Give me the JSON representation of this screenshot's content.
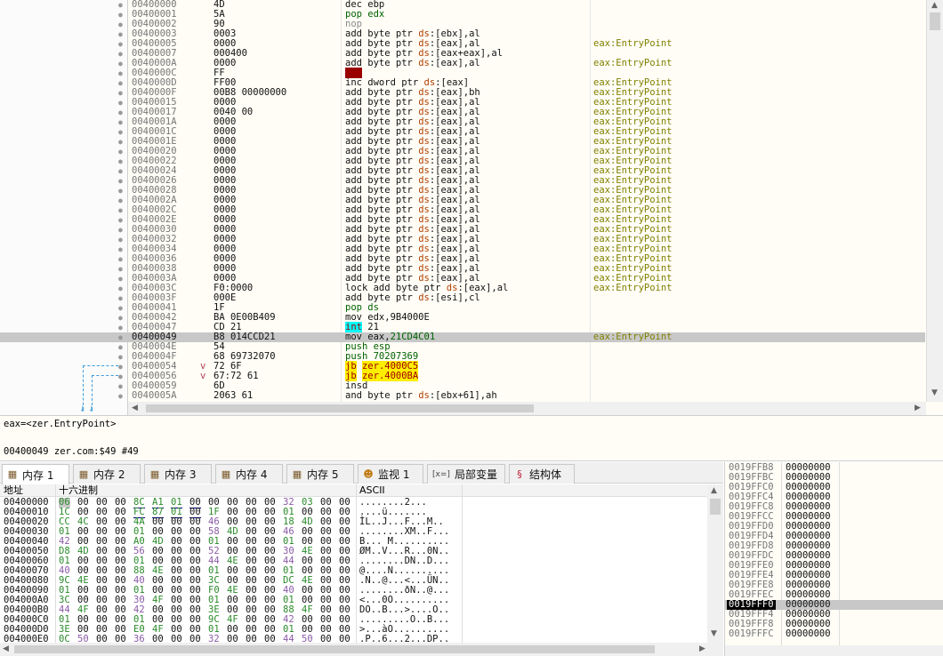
{
  "disasm": {
    "rows": [
      {
        "addr": "00400000",
        "bytes": "4D",
        "ins": [
          [
            "k-dec",
            "dec ebp"
          ]
        ],
        "cmt": ""
      },
      {
        "addr": "00400001",
        "bytes": "5A",
        "ins": [
          [
            "k-pop",
            "pop edx"
          ]
        ],
        "cmt": ""
      },
      {
        "addr": "00400002",
        "bytes": "90",
        "ins": [
          [
            "k-nop",
            "nop"
          ]
        ],
        "cmt": ""
      },
      {
        "addr": "00400003",
        "bytes": "0003",
        "ins": [
          [
            "k-add",
            "add byte ptr "
          ],
          [
            "k-seg",
            "ds"
          ],
          [
            "k-add",
            ":[ebx],al"
          ]
        ],
        "cmt": ""
      },
      {
        "addr": "00400005",
        "bytes": "0000",
        "ins": [
          [
            "k-add",
            "add byte ptr "
          ],
          [
            "k-seg",
            "ds"
          ],
          [
            "k-add",
            ":[eax],al"
          ]
        ],
        "cmt": "eax:EntryPoint"
      },
      {
        "addr": "00400007",
        "bytes": "000400",
        "ins": [
          [
            "k-add",
            "add byte ptr "
          ],
          [
            "k-seg",
            "ds"
          ],
          [
            "k-add",
            ":[eax+eax],al"
          ]
        ],
        "cmt": ""
      },
      {
        "addr": "0040000A",
        "bytes": "0000",
        "ins": [
          [
            "k-add",
            "add byte ptr "
          ],
          [
            "k-seg",
            "ds"
          ],
          [
            "k-add",
            ":[eax],al"
          ]
        ],
        "cmt": "eax:EntryPoint"
      },
      {
        "addr": "0040000C",
        "bytes": "FF",
        "ins": [
          [
            "k-red",
            "???"
          ]
        ],
        "cmt": ""
      },
      {
        "addr": "0040000D",
        "bytes": "FF00",
        "ins": [
          [
            "k-add",
            "inc dword ptr "
          ],
          [
            "k-seg",
            "ds"
          ],
          [
            "k-add",
            ":[eax]"
          ]
        ],
        "cmt": "eax:EntryPoint"
      },
      {
        "addr": "0040000F",
        "bytes": "00B8 00000000",
        "ins": [
          [
            "k-add",
            "add byte ptr "
          ],
          [
            "k-seg",
            "ds"
          ],
          [
            "k-add",
            ":[eax],bh"
          ]
        ],
        "cmt": "eax:EntryPoint"
      },
      {
        "addr": "00400015",
        "bytes": "0000",
        "ins": [
          [
            "k-add",
            "add byte ptr "
          ],
          [
            "k-seg",
            "ds"
          ],
          [
            "k-add",
            ":[eax],al"
          ]
        ],
        "cmt": "eax:EntryPoint"
      },
      {
        "addr": "00400017",
        "bytes": "0040 00",
        "ins": [
          [
            "k-add",
            "add byte ptr "
          ],
          [
            "k-seg",
            "ds"
          ],
          [
            "k-add",
            ":[eax],al"
          ]
        ],
        "cmt": "eax:EntryPoint"
      },
      {
        "addr": "0040001A",
        "bytes": "0000",
        "ins": [
          [
            "k-add",
            "add byte ptr "
          ],
          [
            "k-seg",
            "ds"
          ],
          [
            "k-add",
            ":[eax],al"
          ]
        ],
        "cmt": "eax:EntryPoint"
      },
      {
        "addr": "0040001C",
        "bytes": "0000",
        "ins": [
          [
            "k-add",
            "add byte ptr "
          ],
          [
            "k-seg",
            "ds"
          ],
          [
            "k-add",
            ":[eax],al"
          ]
        ],
        "cmt": "eax:EntryPoint"
      },
      {
        "addr": "0040001E",
        "bytes": "0000",
        "ins": [
          [
            "k-add",
            "add byte ptr "
          ],
          [
            "k-seg",
            "ds"
          ],
          [
            "k-add",
            ":[eax],al"
          ]
        ],
        "cmt": "eax:EntryPoint"
      },
      {
        "addr": "00400020",
        "bytes": "0000",
        "ins": [
          [
            "k-add",
            "add byte ptr "
          ],
          [
            "k-seg",
            "ds"
          ],
          [
            "k-add",
            ":[eax],al"
          ]
        ],
        "cmt": "eax:EntryPoint"
      },
      {
        "addr": "00400022",
        "bytes": "0000",
        "ins": [
          [
            "k-add",
            "add byte ptr "
          ],
          [
            "k-seg",
            "ds"
          ],
          [
            "k-add",
            ":[eax],al"
          ]
        ],
        "cmt": "eax:EntryPoint"
      },
      {
        "addr": "00400024",
        "bytes": "0000",
        "ins": [
          [
            "k-add",
            "add byte ptr "
          ],
          [
            "k-seg",
            "ds"
          ],
          [
            "k-add",
            ":[eax],al"
          ]
        ],
        "cmt": "eax:EntryPoint"
      },
      {
        "addr": "00400026",
        "bytes": "0000",
        "ins": [
          [
            "k-add",
            "add byte ptr "
          ],
          [
            "k-seg",
            "ds"
          ],
          [
            "k-add",
            ":[eax],al"
          ]
        ],
        "cmt": "eax:EntryPoint"
      },
      {
        "addr": "00400028",
        "bytes": "0000",
        "ins": [
          [
            "k-add",
            "add byte ptr "
          ],
          [
            "k-seg",
            "ds"
          ],
          [
            "k-add",
            ":[eax],al"
          ]
        ],
        "cmt": "eax:EntryPoint"
      },
      {
        "addr": "0040002A",
        "bytes": "0000",
        "ins": [
          [
            "k-add",
            "add byte ptr "
          ],
          [
            "k-seg",
            "ds"
          ],
          [
            "k-add",
            ":[eax],al"
          ]
        ],
        "cmt": "eax:EntryPoint"
      },
      {
        "addr": "0040002C",
        "bytes": "0000",
        "ins": [
          [
            "k-add",
            "add byte ptr "
          ],
          [
            "k-seg",
            "ds"
          ],
          [
            "k-add",
            ":[eax],al"
          ]
        ],
        "cmt": "eax:EntryPoint"
      },
      {
        "addr": "0040002E",
        "bytes": "0000",
        "ins": [
          [
            "k-add",
            "add byte ptr "
          ],
          [
            "k-seg",
            "ds"
          ],
          [
            "k-add",
            ":[eax],al"
          ]
        ],
        "cmt": "eax:EntryPoint"
      },
      {
        "addr": "00400030",
        "bytes": "0000",
        "ins": [
          [
            "k-add",
            "add byte ptr "
          ],
          [
            "k-seg",
            "ds"
          ],
          [
            "k-add",
            ":[eax],al"
          ]
        ],
        "cmt": "eax:EntryPoint"
      },
      {
        "addr": "00400032",
        "bytes": "0000",
        "ins": [
          [
            "k-add",
            "add byte ptr "
          ],
          [
            "k-seg",
            "ds"
          ],
          [
            "k-add",
            ":[eax],al"
          ]
        ],
        "cmt": "eax:EntryPoint"
      },
      {
        "addr": "00400034",
        "bytes": "0000",
        "ins": [
          [
            "k-add",
            "add byte ptr "
          ],
          [
            "k-seg",
            "ds"
          ],
          [
            "k-add",
            ":[eax],al"
          ]
        ],
        "cmt": "eax:EntryPoint"
      },
      {
        "addr": "00400036",
        "bytes": "0000",
        "ins": [
          [
            "k-add",
            "add byte ptr "
          ],
          [
            "k-seg",
            "ds"
          ],
          [
            "k-add",
            ":[eax],al"
          ]
        ],
        "cmt": "eax:EntryPoint"
      },
      {
        "addr": "00400038",
        "bytes": "0000",
        "ins": [
          [
            "k-add",
            "add byte ptr "
          ],
          [
            "k-seg",
            "ds"
          ],
          [
            "k-add",
            ":[eax],al"
          ]
        ],
        "cmt": "eax:EntryPoint"
      },
      {
        "addr": "0040003A",
        "bytes": "0000",
        "ins": [
          [
            "k-add",
            "add byte ptr "
          ],
          [
            "k-seg",
            "ds"
          ],
          [
            "k-add",
            ":[eax],al"
          ]
        ],
        "cmt": "eax:EntryPoint"
      },
      {
        "addr": "0040003C",
        "bytes": "F0:0000",
        "ins": [
          [
            "k-add",
            "lock add byte ptr "
          ],
          [
            "k-seg",
            "ds"
          ],
          [
            "k-add",
            ":[eax],al"
          ]
        ],
        "cmt": "eax:EntryPoint"
      },
      {
        "addr": "0040003F",
        "bytes": "000E",
        "ins": [
          [
            "k-add",
            "add byte ptr "
          ],
          [
            "k-seg",
            "ds"
          ],
          [
            "k-add",
            ":[esi],cl"
          ]
        ],
        "cmt": ""
      },
      {
        "addr": "00400041",
        "bytes": "1F",
        "ins": [
          [
            "k-pop",
            "pop ds"
          ]
        ],
        "cmt": ""
      },
      {
        "addr": "00400042",
        "bytes": "BA 0E00B409",
        "ins": [
          [
            "k-mov",
            "mov edx,9B4000E"
          ]
        ],
        "cmt": ""
      },
      {
        "addr": "00400047",
        "bytes": "CD 21",
        "ins": [
          [
            "k-int",
            "int"
          ],
          [
            "k-add",
            " 21"
          ]
        ],
        "cmt": ""
      },
      {
        "addr": "00400049",
        "bytes": "B8 014CCD21",
        "ins": [
          [
            "k-mov",
            "mov eax,"
          ],
          [
            "k-push",
            "21CD4C01"
          ]
        ],
        "cmt": "eax:EntryPoint",
        "sel": true
      },
      {
        "addr": "0040004E",
        "bytes": "54",
        "ins": [
          [
            "k-push",
            "push esp"
          ]
        ],
        "cmt": ""
      },
      {
        "addr": "0040004F",
        "bytes": "68 69732070",
        "ins": [
          [
            "k-push",
            "push 70207369"
          ]
        ],
        "cmt": ""
      },
      {
        "addr": "00400054",
        "bytes": "72 6F",
        "arrow": "v",
        "ins": [
          [
            "k-jmp",
            "jb"
          ],
          [
            "k-add",
            " "
          ],
          [
            "k-jmp",
            "zer.4000C5"
          ]
        ],
        "cmt": ""
      },
      {
        "addr": "00400056",
        "bytes": "67:72 61",
        "arrow": "v",
        "ins": [
          [
            "k-jmp",
            "jb"
          ],
          [
            "k-add",
            " "
          ],
          [
            "k-jmp",
            "zer.4000BA"
          ]
        ],
        "cmt": ""
      },
      {
        "addr": "00400059",
        "bytes": "6D",
        "ins": [
          [
            "k-add",
            "insd"
          ]
        ],
        "cmt": ""
      },
      {
        "addr": "0040005A",
        "bytes": "2063 61",
        "ins": [
          [
            "k-add",
            "and byte ptr "
          ],
          [
            "k-seg",
            "ds"
          ],
          [
            "k-add",
            ":[ebx+61],ah"
          ]
        ],
        "cmt": ""
      }
    ]
  },
  "info": {
    "line1": "eax=<zer.EntryPoint>",
    "line2": "00400049 zer.com:$49 #49"
  },
  "tabs": [
    {
      "label": "内存 1",
      "icon": "memory-icon",
      "active": true
    },
    {
      "label": "内存 2",
      "icon": "memory-icon"
    },
    {
      "label": "内存 3",
      "icon": "memory-icon"
    },
    {
      "label": "内存 4",
      "icon": "memory-icon"
    },
    {
      "label": "内存 5",
      "icon": "memory-icon"
    },
    {
      "label": "监视 1",
      "icon": "watch-icon"
    },
    {
      "label": "局部变量",
      "icon": "locals-icon",
      "prefix": "[x=]"
    },
    {
      "label": "结构体",
      "icon": "struct-icon"
    }
  ],
  "dump": {
    "headers": {
      "addr": "地址",
      "hex": "十六进制",
      "ascii": "ASCII"
    },
    "rows": [
      {
        "addr": "00400000",
        "bytes": [
          "06",
          "00",
          "00",
          "00",
          "8C",
          "A1",
          "01",
          "00",
          "00",
          "00",
          "00",
          "00",
          "32",
          "03",
          "00",
          "00"
        ],
        "ascii": "........2..."
      },
      {
        "addr": "00400010",
        "bytes": [
          "1C",
          "00",
          "00",
          "00",
          "FC",
          "87",
          "01",
          "00",
          "1F",
          "00",
          "00",
          "00",
          "01",
          "00",
          "00",
          "00"
        ],
        "ascii": "....ü......."
      },
      {
        "addr": "00400020",
        "bytes": [
          "CC",
          "4C",
          "00",
          "00",
          "4A",
          "00",
          "00",
          "00",
          "46",
          "00",
          "00",
          "00",
          "18",
          "4D",
          "00",
          "00"
        ],
        "ascii": "ÌL..J...F...M.."
      },
      {
        "addr": "00400030",
        "bytes": [
          "01",
          "00",
          "00",
          "00",
          "01",
          "00",
          "00",
          "00",
          "58",
          "4D",
          "00",
          "00",
          "46",
          "00",
          "00",
          "00"
        ],
        "ascii": "........XM..F..."
      },
      {
        "addr": "00400040",
        "bytes": [
          "42",
          "00",
          "00",
          "00",
          "A0",
          "4D",
          "00",
          "00",
          "01",
          "00",
          "00",
          "00",
          "01",
          "00",
          "00",
          "00"
        ],
        "ascii": "B... M.........."
      },
      {
        "addr": "00400050",
        "bytes": [
          "D8",
          "4D",
          "00",
          "00",
          "56",
          "00",
          "00",
          "00",
          "52",
          "00",
          "00",
          "00",
          "30",
          "4E",
          "00",
          "00"
        ],
        "ascii": "ØM..V...R...0N.."
      },
      {
        "addr": "00400060",
        "bytes": [
          "01",
          "00",
          "00",
          "00",
          "01",
          "00",
          "00",
          "00",
          "44",
          "4E",
          "00",
          "00",
          "44",
          "00",
          "00",
          "00"
        ],
        "ascii": "........DN..D..."
      },
      {
        "addr": "00400070",
        "bytes": [
          "40",
          "00",
          "00",
          "00",
          "88",
          "4E",
          "00",
          "00",
          "01",
          "00",
          "00",
          "00",
          "01",
          "00",
          "00",
          "00"
        ],
        "ascii": "@....N.........."
      },
      {
        "addr": "00400080",
        "bytes": [
          "9C",
          "4E",
          "00",
          "00",
          "40",
          "00",
          "00",
          "00",
          "3C",
          "00",
          "00",
          "00",
          "DC",
          "4E",
          "00",
          "00"
        ],
        "ascii": ".N..@...<...ÜN.."
      },
      {
        "addr": "00400090",
        "bytes": [
          "01",
          "00",
          "00",
          "00",
          "01",
          "00",
          "00",
          "00",
          "F0",
          "4E",
          "00",
          "00",
          "40",
          "00",
          "00",
          "00"
        ],
        "ascii": "........ðN..@..."
      },
      {
        "addr": "004000A0",
        "bytes": [
          "3C",
          "00",
          "00",
          "00",
          "30",
          "4F",
          "00",
          "00",
          "01",
          "00",
          "00",
          "00",
          "01",
          "00",
          "00",
          "00"
        ],
        "ascii": "<...0O.........."
      },
      {
        "addr": "004000B0",
        "bytes": [
          "44",
          "4F",
          "00",
          "00",
          "42",
          "00",
          "00",
          "00",
          "3E",
          "00",
          "00",
          "00",
          "88",
          "4F",
          "00",
          "00"
        ],
        "ascii": "DO..B...>....O.."
      },
      {
        "addr": "004000C0",
        "bytes": [
          "01",
          "00",
          "00",
          "00",
          "01",
          "00",
          "00",
          "00",
          "9C",
          "4F",
          "00",
          "00",
          "42",
          "00",
          "00",
          "00"
        ],
        "ascii": ".........O..B..."
      },
      {
        "addr": "004000D0",
        "bytes": [
          "3E",
          "00",
          "00",
          "00",
          "E0",
          "4F",
          "00",
          "00",
          "01",
          "00",
          "00",
          "00",
          "01",
          "00",
          "00",
          "00"
        ],
        "ascii": ">...àO.........."
      },
      {
        "addr": "004000E0",
        "bytes": [
          "0C",
          "50",
          "00",
          "00",
          "36",
          "00",
          "00",
          "00",
          "32",
          "00",
          "00",
          "00",
          "44",
          "50",
          "00",
          "00"
        ],
        "ascii": ".P..6...2...DP.."
      }
    ]
  },
  "stack": {
    "rows": [
      {
        "addr": "0019FFB8",
        "val": "00000000"
      },
      {
        "addr": "0019FFBC",
        "val": "00000000"
      },
      {
        "addr": "0019FFC0",
        "val": "00000000"
      },
      {
        "addr": "0019FFC4",
        "val": "00000000"
      },
      {
        "addr": "0019FFC8",
        "val": "00000000"
      },
      {
        "addr": "0019FFCC",
        "val": "00000000"
      },
      {
        "addr": "0019FFD0",
        "val": "00000000"
      },
      {
        "addr": "0019FFD4",
        "val": "00000000"
      },
      {
        "addr": "0019FFD8",
        "val": "00000000"
      },
      {
        "addr": "0019FFDC",
        "val": "00000000"
      },
      {
        "addr": "0019FFE0",
        "val": "00000000"
      },
      {
        "addr": "0019FFE4",
        "val": "00000000"
      },
      {
        "addr": "0019FFE8",
        "val": "00000000"
      },
      {
        "addr": "0019FFEC",
        "val": "00000000"
      },
      {
        "addr": "0019FFF0",
        "val": "00000000",
        "sel": true
      },
      {
        "addr": "0019FFF4",
        "val": "00000000"
      },
      {
        "addr": "0019FFF8",
        "val": "00000000"
      },
      {
        "addr": "0019FFFC",
        "val": "00000000"
      }
    ]
  }
}
